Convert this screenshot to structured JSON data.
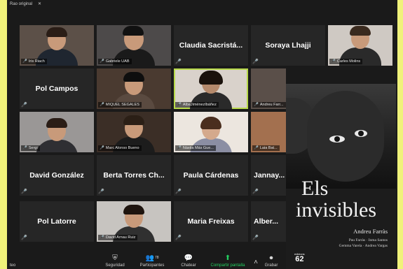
{
  "window": {
    "top_label": "Rao original"
  },
  "tiles": [
    {
      "type": "video",
      "caption": "Iris Riach",
      "muted": true
    },
    {
      "type": "video",
      "caption": "Gabriele UAB",
      "muted": true
    },
    {
      "type": "name",
      "name": "Claudia Sacristá..."
    },
    {
      "type": "name",
      "name": "Soraya Lhajji"
    },
    {
      "type": "video",
      "caption": "Carles Molins",
      "muted": true
    },
    {
      "type": "name",
      "name": "Pol Campos"
    },
    {
      "type": "video",
      "caption": "MIQUEL SEGALES",
      "muted": true
    },
    {
      "type": "video",
      "caption": "AlbaJiménezIbáñez",
      "muted": true,
      "active": true
    },
    {
      "type": "video",
      "caption": "Andreu Farr...",
      "muted": true
    },
    {
      "type": "video",
      "caption": "Sergi",
      "muted": true
    },
    {
      "type": "video",
      "caption": "Marc Alonso Bueno",
      "muted": true
    },
    {
      "type": "video",
      "caption": "Nàstia Más Gue...",
      "muted": true
    },
    {
      "type": "video",
      "caption": "Laia Bat...",
      "muted": true
    },
    {
      "type": "name",
      "name": "David González"
    },
    {
      "type": "name",
      "name": "Berta Torres Ch..."
    },
    {
      "type": "name",
      "name": "Paula Cárdenas"
    },
    {
      "type": "name",
      "name": "Jannay..."
    },
    {
      "type": "name",
      "name": "Pol Latorre"
    },
    {
      "type": "video",
      "caption": "David Arnau Ruiz",
      "muted": true
    },
    {
      "type": "name",
      "name": "Maria Freixas"
    },
    {
      "type": "name",
      "name": "Alber..."
    }
  ],
  "toolbar": {
    "left_label": "teo",
    "security": "Seguridad",
    "participants": "Participantes",
    "participants_count": "78",
    "chat": "Chatear",
    "share": "Compartir pantalla",
    "record": "Grabar"
  },
  "book": {
    "title_line1": "Els",
    "title_line2": "invisibles",
    "author": "Andreu Farràs",
    "coauthors_line1": "Pau Farràs · Inma Santos",
    "coauthors_line2": "Gemma Varela · Andrea Vargas",
    "logo_small": "edicions",
    "logo_number": "62"
  }
}
